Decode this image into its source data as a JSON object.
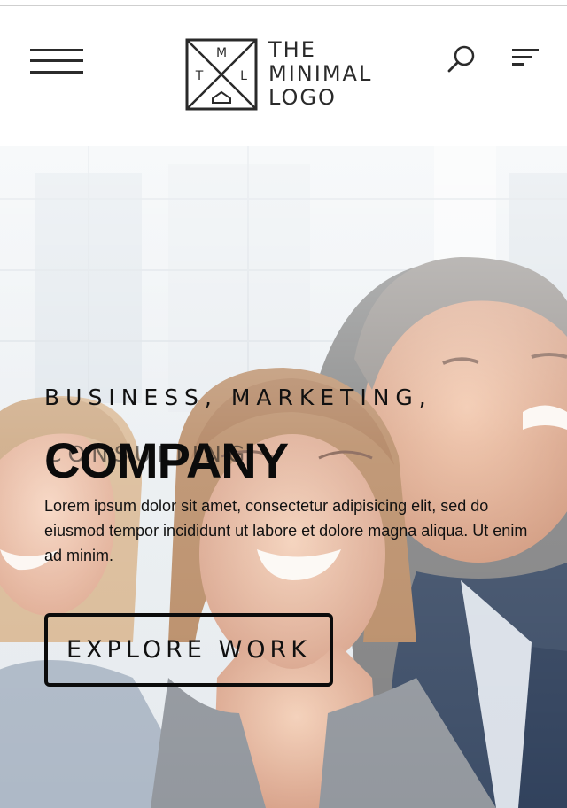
{
  "header": {
    "logo_monogram": [
      "M",
      "T",
      "L"
    ],
    "logo_lines": [
      "THE",
      "MINIMAL",
      "LOGO"
    ]
  },
  "hero": {
    "eyebrow": "BUSINESS, MARKETING,",
    "eyebrow_faded": "CONSULTING",
    "headline": "COMPANY",
    "body": "Lorem ipsum dolor sit amet, consectetur adipisicing elit, sed do eiusmod tempor incididunt ut labore et dolore magna aliqua. Ut enim ad minim.",
    "cta_label": "EXPLORE WORK"
  },
  "icons": [
    "hamburger-menu-icon",
    "search-icon",
    "filter-menu-icon"
  ],
  "colors": {
    "text_dark": "#111111",
    "header_bg": "#ffffff"
  }
}
